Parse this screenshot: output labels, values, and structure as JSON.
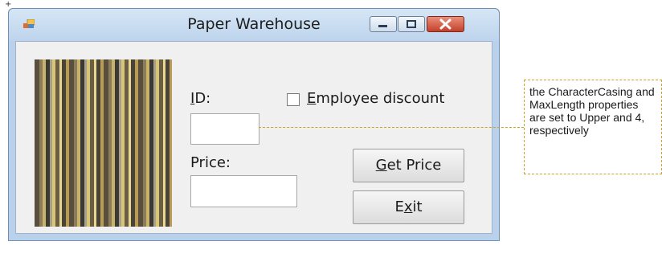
{
  "window": {
    "title": "Paper Warehouse",
    "icons": {
      "app": "app-icon",
      "minimize": "minimize-icon",
      "maximize": "maximize-icon",
      "close": "close-icon"
    }
  },
  "form": {
    "id_label_prefix": "",
    "id_label_mnemonic": "I",
    "id_label_rest": "D:",
    "id_value": "",
    "price_label": "Price:",
    "price_value": "",
    "discount_mnemonic": "E",
    "discount_rest": "mployee discount",
    "discount_checked": false,
    "get_price_mnemonic": "G",
    "get_price_rest": "et Price",
    "exit_prefix": "E",
    "exit_mnemonic": "x",
    "exit_rest": "it"
  },
  "callout": {
    "text": "the CharacterCasing and MaxLength properties are set to Upper and 4, respectively"
  },
  "colors": {
    "callout_border": "#c9a327",
    "close_button": "#c4412b",
    "titlebar": "#bdd4ec"
  }
}
